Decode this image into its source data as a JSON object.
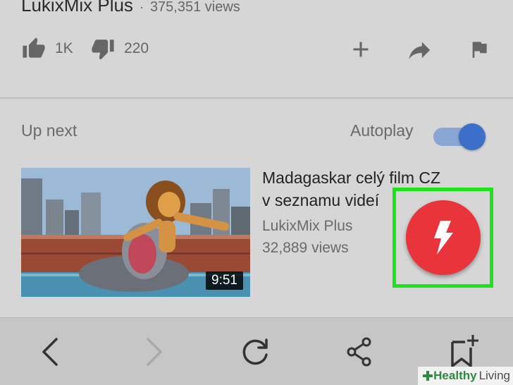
{
  "video": {
    "channel": "LukixMix Plus",
    "separator": "·",
    "views": "375,351 views",
    "likes": "1K",
    "dislikes": "220"
  },
  "upnext": {
    "heading": "Up next",
    "autoplay_label": "Autoplay",
    "autoplay_on": true,
    "item": {
      "title_line1": "Madagaskar celý film CZ",
      "title_line2": "v seznamu videí",
      "channel": "LukixMix Plus",
      "views": "32,889 views",
      "duration": "9:51"
    }
  },
  "fab": {
    "icon": "flash-icon",
    "color": "#e8343a"
  },
  "highlight_color": "#19e619",
  "navbar": {
    "icons": [
      "back-icon",
      "forward-icon",
      "reload-icon",
      "share-icon",
      "bookmark-add-icon"
    ]
  },
  "watermark": {
    "part1": "Healthy",
    "part2": "Living"
  }
}
